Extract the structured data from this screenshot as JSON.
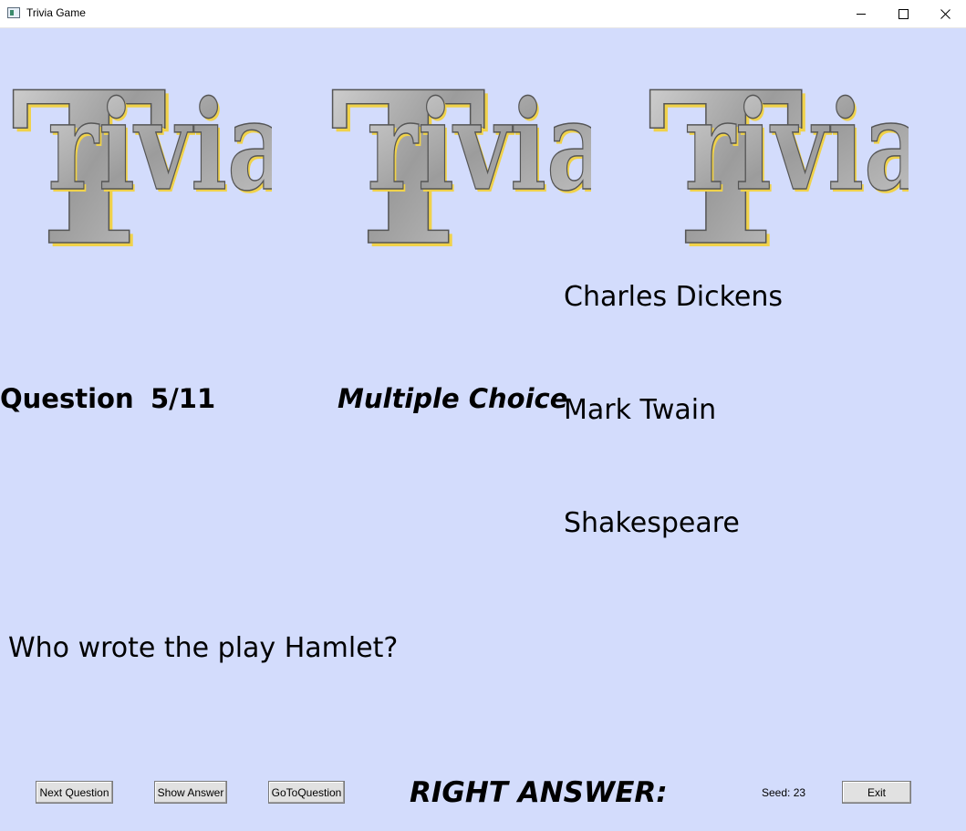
{
  "window": {
    "title": "Trivia Game"
  },
  "logos": [
    {
      "text": "Trivia"
    },
    {
      "text": "Trivia"
    },
    {
      "text": "Trivia"
    }
  ],
  "question": {
    "label": "Question",
    "number": "5/11",
    "type": "Multiple Choice",
    "text": "Who wrote the play Hamlet?"
  },
  "choices": [
    "Charles Dickens",
    "Mark Twain",
    "Shakespeare"
  ],
  "controls": {
    "next_question": "Next Question",
    "show_answer": "Show Answer",
    "goto_question": "GoToQuestion",
    "exit": "Exit"
  },
  "status": {
    "right_answer": "RIGHT ANSWER:",
    "seed": "Seed: 23"
  },
  "colors": {
    "background": "#d3dcfc",
    "logo_fill": "#a8a8a8",
    "logo_shadow": "#f0d24a"
  }
}
